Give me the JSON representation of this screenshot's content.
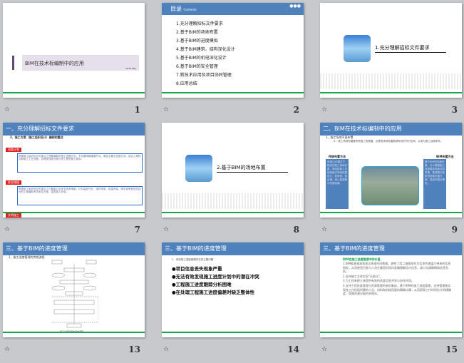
{
  "colors": {
    "header": "#4f81bd",
    "accent_line": "#13a64b",
    "background": "#c7c9cc"
  },
  "transition_icon": "animation-star-icon",
  "slides": [
    {
      "number": "1",
      "title": "BIM在技术标编制中的应用",
      "date": "2016.06()"
    },
    {
      "number": "2",
      "header": "目录",
      "header_sub": "Contents",
      "items": [
        "1.充分理解招标文件要求",
        "2.基于BIM的场地布置",
        "3.基于BIM的进度模拟",
        "4.基于BIM建筑、结构深化设计",
        "5.基于BIM的机电深化设计",
        "6.基于BIM的安全管理",
        "7.新技术应用及项目协同管理",
        "8.应用总结"
      ]
    },
    {
      "number": "3",
      "section_title": "1.充分理解招标文件要求"
    },
    {
      "number": "7",
      "header": "一、充分理解招标文件要求",
      "sub": "3、施工方案（施工组织设计）编制的重点",
      "tags": [
        "进度计划",
        "安全措施",
        "文明施工"
      ],
      "paras": [
        "根据施工组织设计的重点之首要编制好施工进度计划，不仅要明确重要节点，确定主要总进度计划，结合工程特点和施工工艺流程，合理安排各分部分项工程的施工顺序。",
        "根据施工组织设计的重点之六要制订出安全技术措施，针对高处作业、临时用电、起重吊装、脚手架等危险性较大的工程编制专项安全方案，保障施工安全。",
        "根据施工组织设计的重点之七是做好文明施工策划，减少对周边环境的影响，合理布置施工现场，做好扬尘治理与环境保护。"
      ]
    },
    {
      "number": "8",
      "section_title": "2.基于BIM的场地布置"
    },
    {
      "number": "9",
      "header": "二、BIM在技术标编制中的应用",
      "sub": "1、施工场地平面布置",
      "desc": "（1）施工场地布置要考虑施工的便捷、合理的场地布置能够有效的节约空间，从而为施工创造条件。",
      "left_label": "传统布置方法",
      "right_label": "BIM布置方法",
      "left_text": "传统CAD模式下静态的施工场地布置，单纯依靠人员经验进行场地布置设计，效率低、易出错，难以直观展示布置效果。",
      "right_text": "基于BIM的场地布置，可以根据施工进度模拟场地动态布置，直观展示各阶段场地布置方案，提高布置合理性。"
    },
    {
      "number": "13",
      "header": "三、基于BIM的进度管理",
      "sub": "1、施工进度管理的传统流程",
      "caption": "施工进度管理的传统流程"
    },
    {
      "number": "14",
      "header": "三、基于BIM的进度管理",
      "sub": "2、传统施工进度管理存在的主要问题",
      "bullets": [
        "●项目信息丢失现象严重",
        "●无法有效发现施工进度计划中的潜在冲突",
        "●工程施工进度跟踪分析困难",
        "●在处理工程施工进度偏差时缺乏整体性"
      ]
    },
    {
      "number": "15",
      "header": "三、基于BIM的进度管理",
      "green_title": "BIM在施工进度管理中的价值",
      "paras": [
        "1.BIM能直观高效表达多维空间数据，避免了用二维图纸作为信息传递媒介带来的信息损失，从而使项目参与人员在最短时间内准确理解设计信息，减少沟通障碍和信息丢失。",
        "2.支持施工主体实现“无纸化”。",
        "3.为工程参建主体提供有效的进度信息共享与协作环境。",
        "4.支持工程进度管理与资源管理的有机集成，基于BIM的施工进度管理，支持管理者实现各工作阶段所需的人员、材料和机械用量的精确计算，从而提高工作时间估计的精确度，保障资源分配的合理化。"
      ]
    }
  ]
}
